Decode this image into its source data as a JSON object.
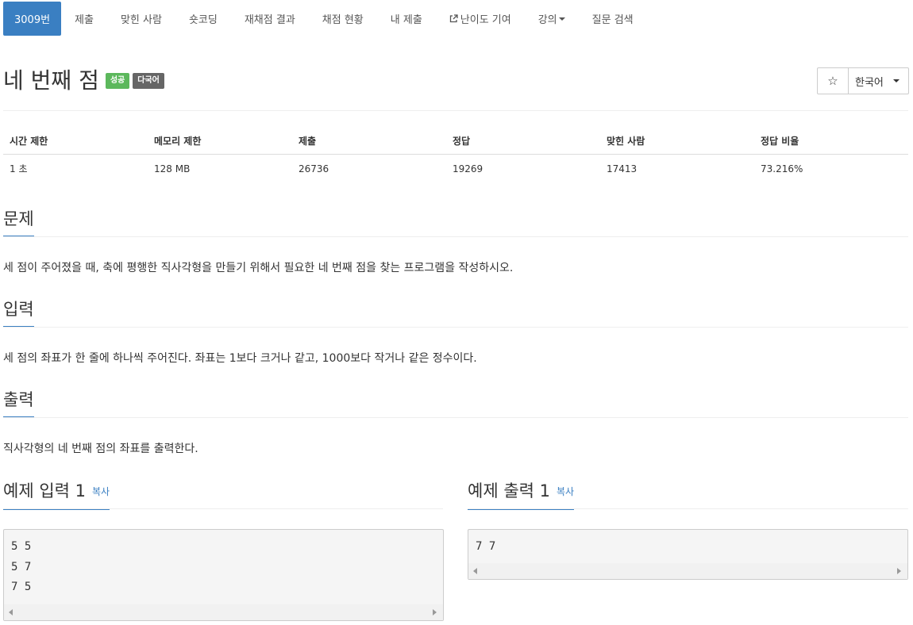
{
  "nav": {
    "problem_id": "3009번",
    "tabs": [
      "제출",
      "맞힌 사람",
      "숏코딩",
      "재채점 결과",
      "채점 현황",
      "내 제출",
      "난이도 기여",
      "강의"
    ],
    "last_tab": "질문 검색",
    "ext_icon": "external-link-icon",
    "dropdown_icon": "caret-down-icon"
  },
  "problem": {
    "title": "네 번째 점",
    "badges": [
      "성공",
      "다국어"
    ],
    "star": "☆",
    "language": "한국어"
  },
  "stats": {
    "headers": [
      "시간 제한",
      "메모리 제한",
      "제출",
      "정답",
      "맞힌 사람",
      "정답 비율"
    ],
    "values": [
      "1 초",
      "128 MB",
      "26736",
      "19269",
      "17413",
      "73.216%"
    ]
  },
  "sections": {
    "problem_heading": "문제",
    "problem_text": "세 점이 주어졌을 때, 축에 평행한 직사각형을 만들기 위해서 필요한 네 번째 점을 찾는 프로그램을 작성하시오.",
    "input_heading": "입력",
    "input_text": "세 점의 좌표가 한 줄에 하나씩 주어진다. 좌표는 1보다 크거나 같고, 1000보다 작거나 같은 정수이다.",
    "output_heading": "출력",
    "output_text": "직사각형의 네 번째 점의 좌표를 출력한다."
  },
  "samples": {
    "input_heading": "예제 입력 1",
    "output_heading": "예제 출력 1",
    "copy_label": "복사",
    "input_text": "5 5\n5 7\n7 5",
    "output_text": "7 7"
  },
  "colors": {
    "accent": "#3a7fc2",
    "success": "#5cb85c",
    "multilang": "#666666"
  }
}
